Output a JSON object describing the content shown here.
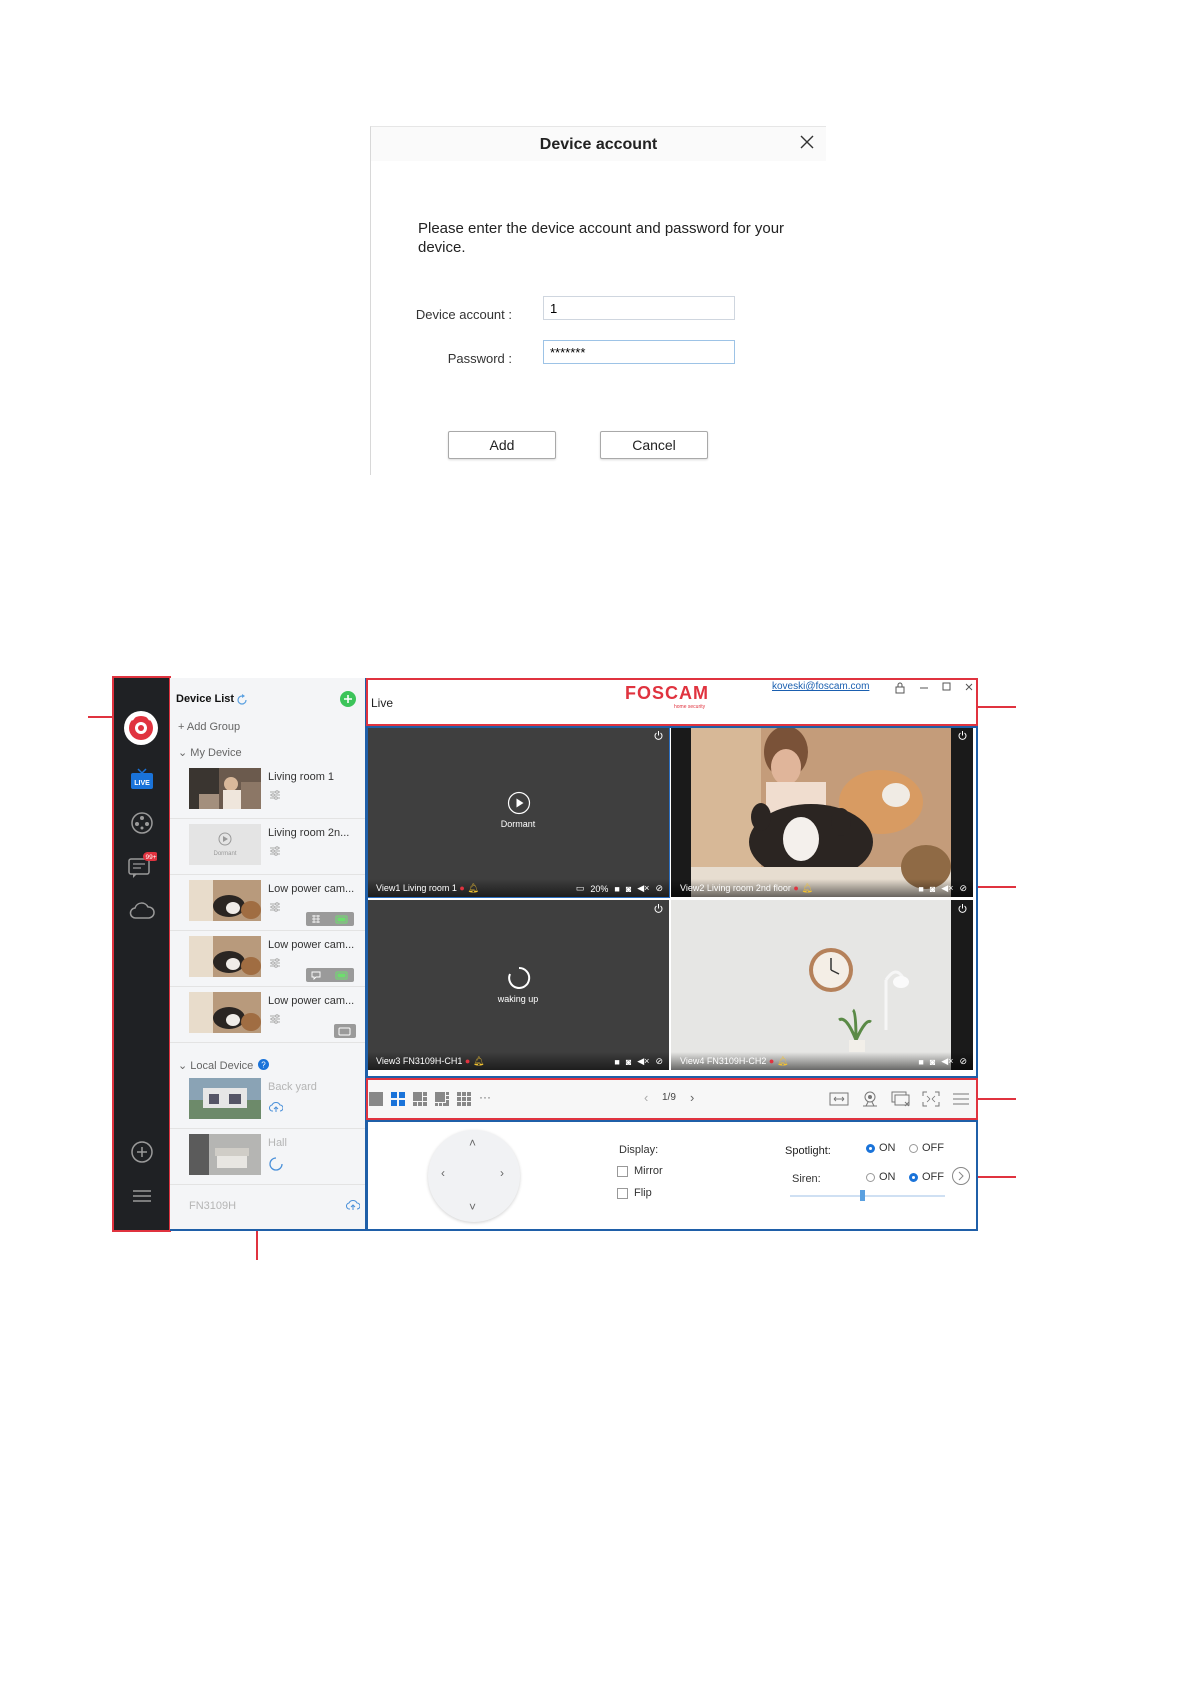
{
  "dialog": {
    "title": "Device account",
    "message": "Please enter the device account and password for your device.",
    "account_label": "Device account :",
    "account_value": "1",
    "password_label": "Password :",
    "password_value": "*******",
    "add_label": "Add",
    "cancel_label": "Cancel"
  },
  "app": {
    "rail": {
      "live_badge": "LIVE",
      "message_badge": "99+"
    },
    "device_list": {
      "title": "Device List",
      "add_group": "Add Group",
      "my_device": "My Device",
      "items": [
        {
          "name": "Living room 1"
        },
        {
          "name": "Living room 2n...",
          "thumb_text": "Dormant"
        },
        {
          "name": "Low power cam..."
        },
        {
          "name": "Low power cam..."
        },
        {
          "name": "Low power cam..."
        }
      ],
      "local_device": "Local Device",
      "local_items": [
        {
          "name": "Back yard"
        },
        {
          "name": "Hall"
        }
      ],
      "footer_device": "FN3109H"
    },
    "topbar": {
      "section": "Live",
      "brand": "FOSCAM",
      "brand_sub": "home security",
      "email": "koveski@foscam.com"
    },
    "views": [
      {
        "label": "View1 Living room 1",
        "center_text": "Dormant",
        "battery": "20%"
      },
      {
        "label": "View2 Living room 2nd floor"
      },
      {
        "label": "View3 FN3109H-CH1",
        "center_text": "waking up"
      },
      {
        "label": "View4 FN3109H-CH2"
      }
    ],
    "toolbar": {
      "page": "1/9",
      "more": "···"
    },
    "controls": {
      "display_label": "Display:",
      "mirror_label": "Mirror",
      "flip_label": "Flip",
      "spotlight_label": "Spotlight:",
      "siren_label": "Siren:",
      "on_label": "ON",
      "off_label": "OFF",
      "spotlight_state": "ON",
      "siren_state": "OFF"
    }
  },
  "colors": {
    "callout_red": "#e0333f",
    "rail_bg": "#1f2124",
    "accent_blue": "#1a73d9",
    "brand_red": "#e0333f",
    "add_green": "#3cc45a"
  }
}
